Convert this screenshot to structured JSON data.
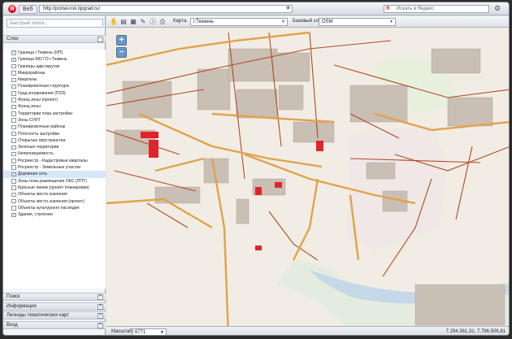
{
  "browser": {
    "brand_label": "Веб",
    "url": "http://portal-nsk.itpgrad.ru/",
    "search_placeholder": "Искать в Яндекс"
  },
  "sidebar": {
    "quick_search_placeholder": "Быстрый поиск...",
    "layers_header": "Слои",
    "layers": [
      {
        "label": "Граница г.Тюмень (ИП)",
        "checked": true
      },
      {
        "label": "Граница МО ГО г.Тюмень",
        "checked": true
      },
      {
        "label": "Границы адм.округов",
        "checked": false
      },
      {
        "label": "Микрорайоны",
        "checked": false
      },
      {
        "label": "Кварталы",
        "checked": false
      },
      {
        "label": "Планировочная структура",
        "checked": false
      },
      {
        "label": "Град.зонирование (ПЗЗ)",
        "checked": false
      },
      {
        "label": "Функц.зоны (проект)",
        "checked": false
      },
      {
        "label": "Функц.зоны",
        "checked": false
      },
      {
        "label": "Территории план.застройки",
        "checked": false
      },
      {
        "label": "Зоны СУИТ",
        "checked": false
      },
      {
        "label": "Планировочные районы",
        "checked": false
      },
      {
        "label": "Плотность застройки",
        "checked": false
      },
      {
        "label": "Открытые пространства",
        "checked": false
      },
      {
        "label": "Зеленые территории",
        "checked": false
      },
      {
        "label": "Непроницаемость",
        "checked": false
      },
      {
        "label": "Росреестр - Кадастровые кварталы",
        "checked": false
      },
      {
        "label": "Росреестр - Земельные участки",
        "checked": false
      },
      {
        "label": "Дорожная сеть",
        "checked": true,
        "selected": true
      },
      {
        "label": "Зоны план.размещения ОКС (ППТ)",
        "checked": false
      },
      {
        "label": "Красные линии (проект планировки)",
        "checked": false
      },
      {
        "label": "Объекты местн.значения",
        "checked": false
      },
      {
        "label": "Объекты местн.значения (проект)",
        "checked": false
      },
      {
        "label": "Объекты культурного наследия",
        "checked": false
      },
      {
        "label": "Здания, строения",
        "checked": true
      }
    ],
    "bottom_panels": [
      "Поиск",
      "Информация",
      "Легенды тематических карт",
      "Вход"
    ]
  },
  "toolbar": {
    "map_label": "Карта:",
    "map_value": "г.Тюмень",
    "base_label": "Базовый слой:",
    "base_value": "OSM"
  },
  "statusbar": {
    "scale_label": "Масштаб:",
    "scale_value": "6771",
    "coordinates": "7.294.361,31; 7.796.506,81"
  },
  "colors": {
    "road_main": "#e2a24a",
    "road_minor": "#b04a20",
    "building": "#c9bfb5",
    "highlight": "#e0242c",
    "river": "#c5d8e8",
    "green": "#cfe3b8"
  }
}
